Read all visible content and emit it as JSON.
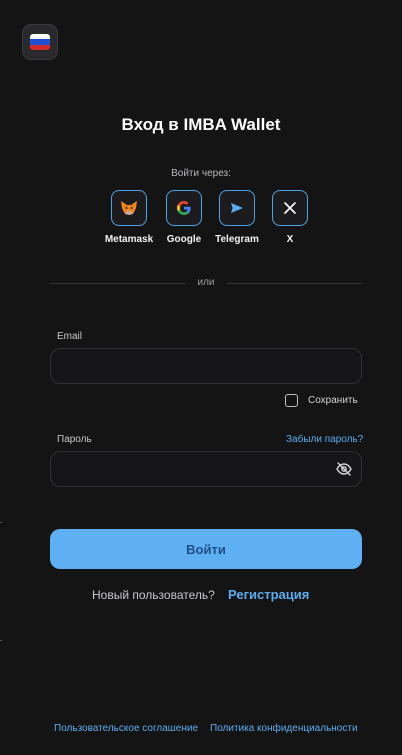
{
  "header": {
    "language": "Русский",
    "language_icon": "russia-flag-icon"
  },
  "title": "Вход в IMBA Wallet",
  "login_via": "Войти через:",
  "social": [
    {
      "label": "Metamask",
      "icon": "metamask-icon"
    },
    {
      "label": "Google",
      "icon": "google-icon"
    },
    {
      "label": "Telegram",
      "icon": "telegram-icon"
    },
    {
      "label": "X",
      "icon": "x-icon"
    }
  ],
  "divider": "или",
  "form": {
    "email_label": "Email",
    "email_value": "",
    "remember_label": "Сохранить",
    "remember_checked": false,
    "password_label": "Пароль",
    "forgot_label": "Забыли пароль?",
    "password_value": "",
    "submit_label": "Войти"
  },
  "register": {
    "prompt": "Новый пользователь?",
    "link": "Регистрация"
  },
  "footer": {
    "terms": "Пользовательское соглашение",
    "privacy": "Политика конфиденциальности"
  },
  "colors": {
    "background": "#141415",
    "accent": "#5fb0f2",
    "link": "#5aaef0",
    "button_text": "#1e4f86"
  }
}
